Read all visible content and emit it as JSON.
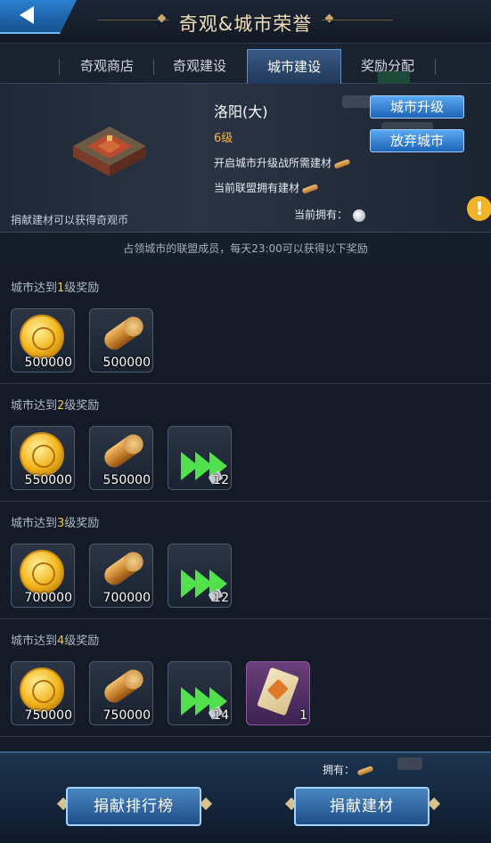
{
  "header": {
    "title": "奇观&城市荣誉"
  },
  "tabs": [
    {
      "label": "奇观商店"
    },
    {
      "label": "奇观建设"
    },
    {
      "label": "城市建设"
    },
    {
      "label": "奖励分配"
    }
  ],
  "active_tab": 2,
  "info": {
    "city_name": "洛阳(大)",
    "level": "6级",
    "upgrade_button": "城市升级",
    "abandon_button": "放弃城市",
    "required_label": "开启城市升级战所需建材",
    "alliance_label": "当前联盟拥有建材",
    "current_label": "当前拥有：",
    "hint": "捐献建材可以获得奇观币"
  },
  "notice": "占领城市的联盟成员，每天23:00可以获得以下奖励",
  "rewards": [
    {
      "prefix": "城市达到",
      "level": "1",
      "suffix": "级奖励",
      "items": [
        {
          "icon": "gold-coin",
          "qty": "500000"
        },
        {
          "icon": "wood-log",
          "qty": "500000"
        }
      ]
    },
    {
      "prefix": "城市达到",
      "level": "2",
      "suffix": "级奖励",
      "items": [
        {
          "icon": "gold-coin",
          "qty": "550000"
        },
        {
          "icon": "wood-log",
          "qty": "550000"
        },
        {
          "icon": "speedup-arrows",
          "qty": "12"
        }
      ]
    },
    {
      "prefix": "城市达到",
      "level": "3",
      "suffix": "级奖励",
      "items": [
        {
          "icon": "gold-coin",
          "qty": "700000"
        },
        {
          "icon": "wood-log",
          "qty": "700000"
        },
        {
          "icon": "speedup-arrows",
          "qty": "12"
        }
      ]
    },
    {
      "prefix": "城市达到",
      "level": "4",
      "suffix": "级奖励",
      "items": [
        {
          "icon": "gold-coin",
          "qty": "750000"
        },
        {
          "icon": "wood-log",
          "qty": "750000"
        },
        {
          "icon": "speedup-arrows",
          "qty": "14"
        },
        {
          "icon": "scroll",
          "qty": "1"
        }
      ]
    }
  ],
  "footer": {
    "own_label": "拥有：",
    "rank_button": "捐献排行榜",
    "donate_button": "捐献建材"
  },
  "colors": {
    "accent_blue": "#2b7fd0",
    "level_gold": "#f2c44a",
    "speed_green": "#52e04c"
  }
}
